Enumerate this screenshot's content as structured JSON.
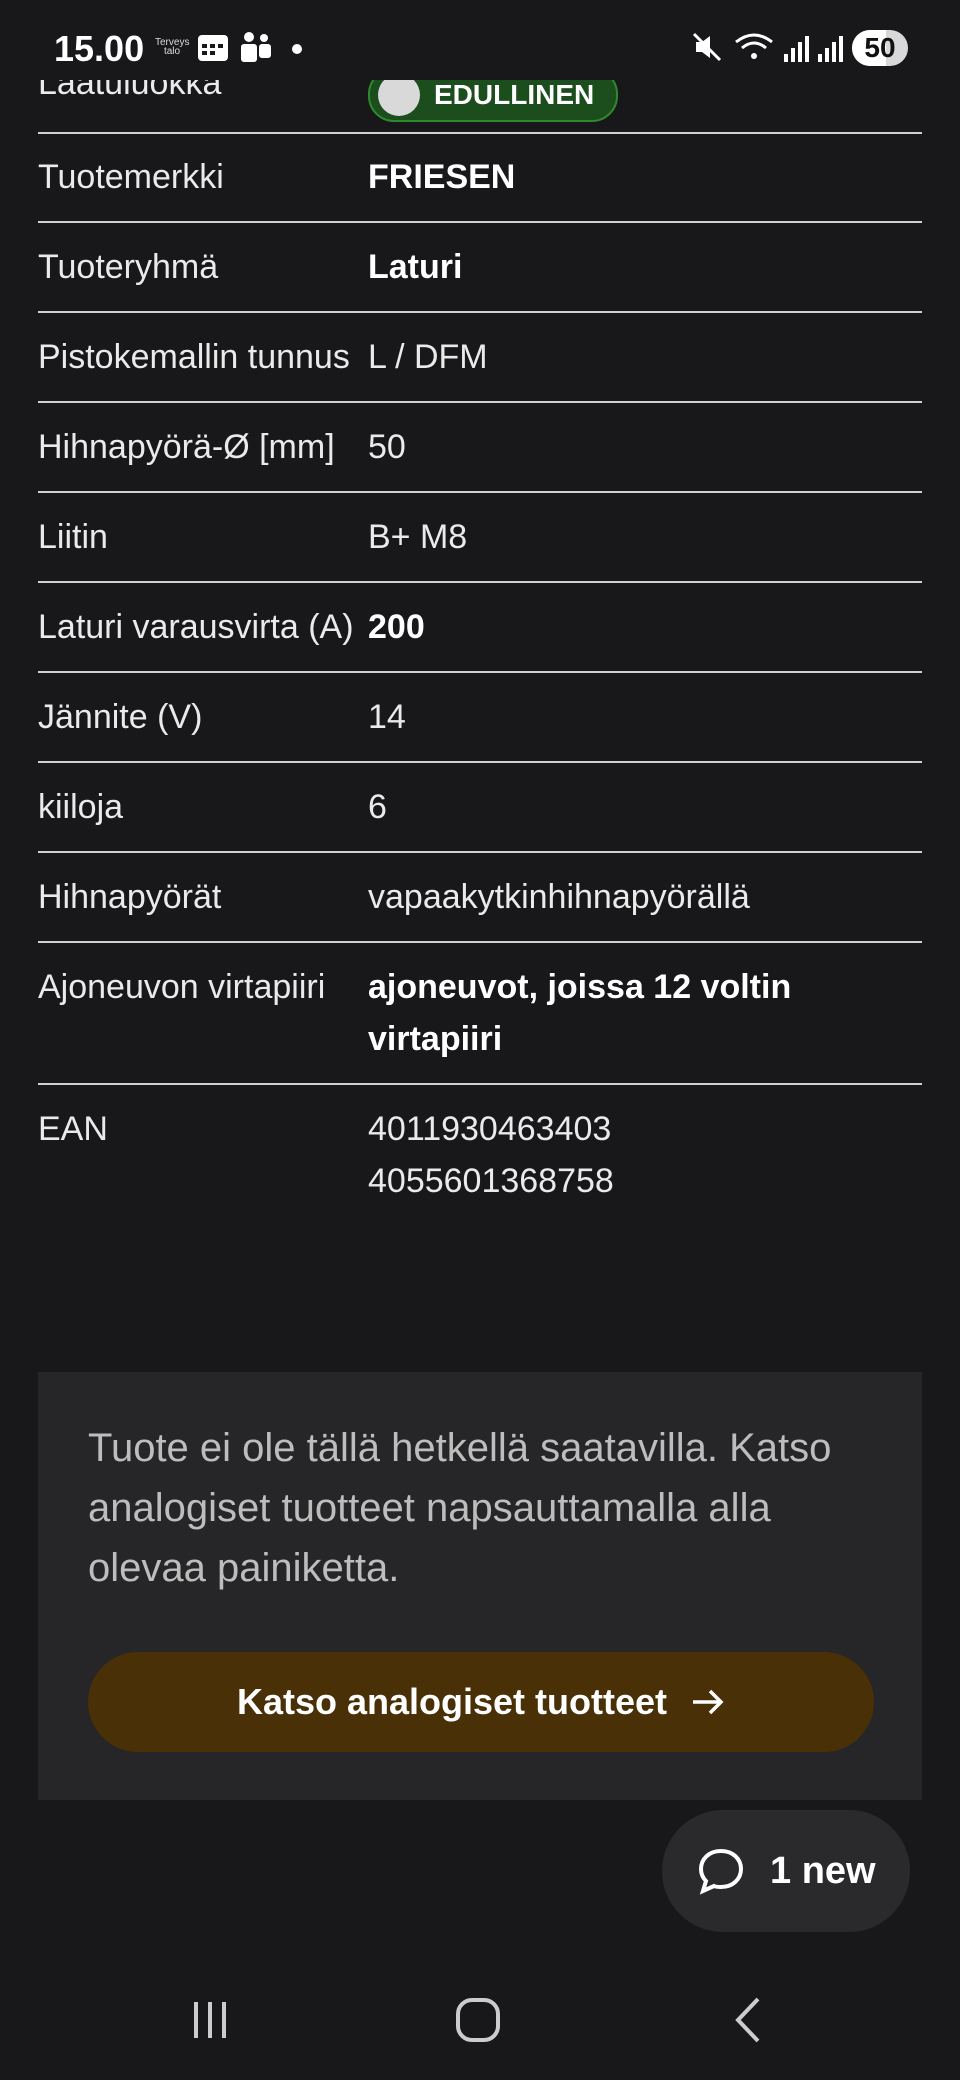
{
  "status_bar": {
    "time": "15.00",
    "app_badge": "Terveys talo",
    "battery": "50"
  },
  "quality": {
    "label": "Laatuluokka",
    "badge_text": "EDULLINEN",
    "badge_color": "#1c4d1c"
  },
  "specs": [
    {
      "key": "Tuotemerkki",
      "value": [
        "FRIESEN"
      ],
      "bold": true
    },
    {
      "key": "Tuoteryhmä",
      "value": [
        "Laturi"
      ],
      "bold": true
    },
    {
      "key": "Pistokemallin tunnus",
      "value": [
        "L / DFM"
      ],
      "bold": false
    },
    {
      "key": "Hihnapyörä-Ø [mm]",
      "value": [
        "50"
      ],
      "bold": false
    },
    {
      "key": "Liitin",
      "value": [
        "B+ M8"
      ],
      "bold": false
    },
    {
      "key": "Laturi varausvirta (A)",
      "value": [
        "200"
      ],
      "bold": true
    },
    {
      "key": "Jännite (V)",
      "value": [
        "14"
      ],
      "bold": false
    },
    {
      "key": "kiiloja",
      "value": [
        "6"
      ],
      "bold": false
    },
    {
      "key": "Hihnapyörät",
      "value": [
        "vapaakytkinhihnapyörällä"
      ],
      "bold": false
    },
    {
      "key": "Ajoneuvon virtapiiri",
      "value": [
        "ajoneuvot, joissa 12 voltin virtapiiri"
      ],
      "bold": true
    },
    {
      "key": "EAN",
      "value": [
        "4011930463403",
        "4055601368758"
      ],
      "bold": false
    }
  ],
  "notice": {
    "text": "Tuote ei ole tällä hetkellä saatavilla. Katso analogiset tuotteet napsauttamalla alla olevaa painiketta.",
    "button_label": "Katso analogiset tuotteet",
    "button_color": "#4a3007"
  },
  "chat": {
    "label": "1 new",
    "icon": "chat-bubble-icon"
  },
  "nav": {
    "recents_icon": "recents-icon",
    "home_icon": "home-icon",
    "back_icon": "back-icon"
  }
}
